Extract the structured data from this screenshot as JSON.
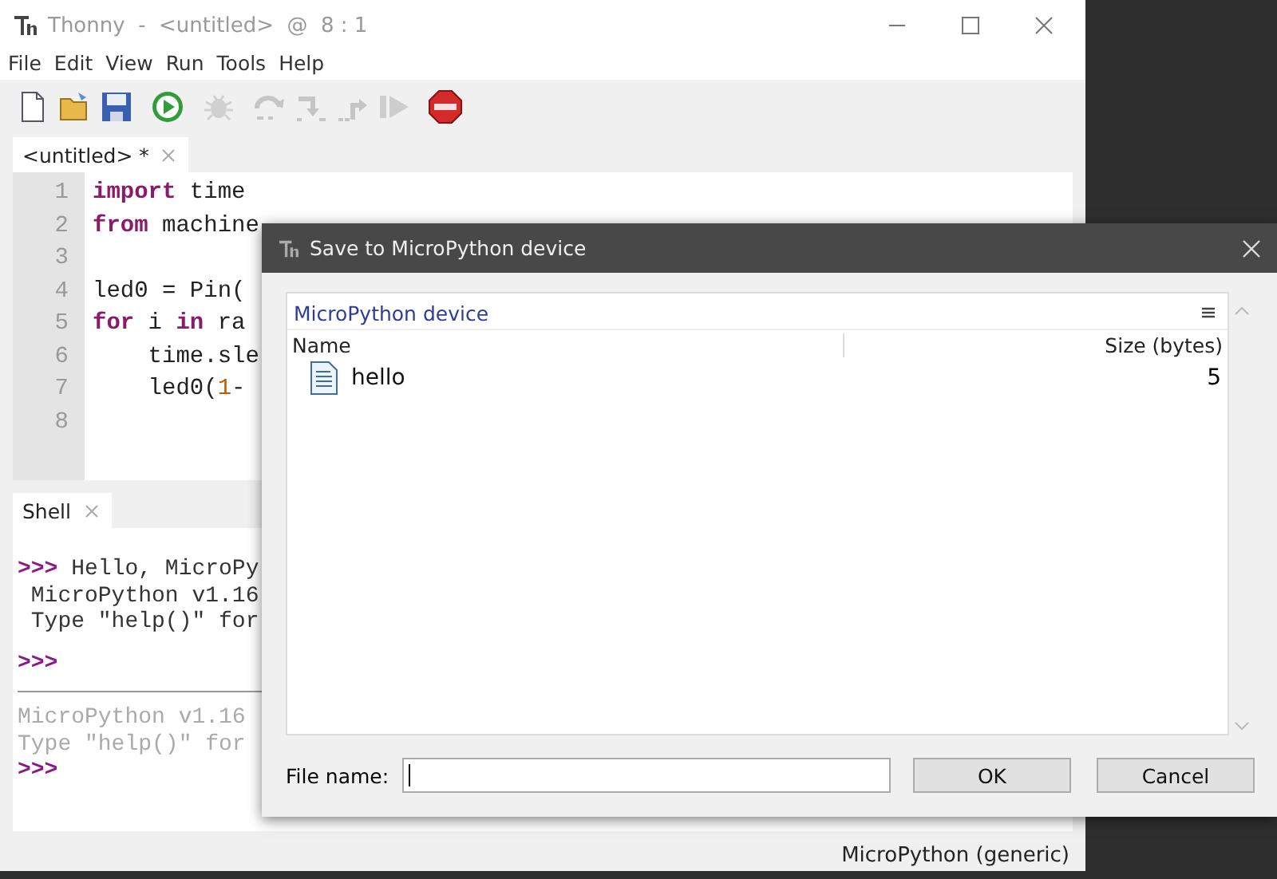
{
  "window": {
    "title": "Thonny  -  <untitled>  @  8 : 1"
  },
  "menu": [
    "File",
    "Edit",
    "View",
    "Run",
    "Tools",
    "Help"
  ],
  "toolbar": [
    {
      "kind": "new",
      "disabled": false
    },
    {
      "kind": "open",
      "disabled": false
    },
    {
      "kind": "save",
      "disabled": false
    },
    {
      "kind": "run",
      "disabled": false
    },
    {
      "kind": "debug",
      "disabled": true
    },
    {
      "kind": "step-over",
      "disabled": true
    },
    {
      "kind": "step-into",
      "disabled": true
    },
    {
      "kind": "step-out",
      "disabled": true
    },
    {
      "kind": "resume",
      "disabled": true
    },
    {
      "kind": "stop",
      "disabled": false
    }
  ],
  "editor": {
    "tabs": [
      {
        "label": "<untitled> *",
        "selected": true
      }
    ],
    "lines": [
      {
        "number": "1",
        "tokens": [
          {
            "kind": "kw",
            "text": "import"
          },
          {
            "kind": "plain",
            "text": " time"
          }
        ]
      },
      {
        "number": "2",
        "tokens": [
          {
            "kind": "kw",
            "text": "from"
          },
          {
            "kind": "plain",
            "text": " machine"
          }
        ]
      },
      {
        "number": "3"
      },
      {
        "number": "4",
        "tokens": [
          {
            "kind": "plain",
            "text": "led0 = Pin("
          }
        ]
      },
      {
        "number": "5",
        "tokens": [
          {
            "kind": "kw",
            "text": "for"
          },
          {
            "kind": "plain",
            "text": " i "
          },
          {
            "kind": "kw",
            "text": "in"
          },
          {
            "kind": "plain",
            "text": " ra"
          }
        ]
      },
      {
        "number": "6",
        "tokens": [
          {
            "kind": "plain",
            "text": "    time.sle"
          }
        ]
      },
      {
        "number": "7",
        "tokens": [
          {
            "kind": "plain",
            "text": "    led0("
          },
          {
            "kind": "num",
            "text": "1"
          },
          {
            "kind": "plain",
            "text": "-"
          }
        ]
      },
      {
        "number": "8"
      }
    ]
  },
  "shell": {
    "tabs": [
      {
        "label": "Shell",
        "selected": true
      }
    ],
    "lines": [
      {
        "kind": "prompt",
        "prompt": ">>>",
        "text": " Hello, MicroPy"
      },
      {
        "kind": "output",
        "text": " MicroPython v1.16"
      },
      {
        "kind": "output",
        "text": " Type \"help()\" for"
      },
      {
        "kind": "prompt",
        "prompt": ">>>"
      },
      {
        "kind": "separator"
      },
      {
        "kind": "faded",
        "text": "MicroPython v1.16"
      },
      {
        "kind": "faded",
        "text": "Type \"help()\" for"
      },
      {
        "kind": "prompt",
        "prompt": ">>>"
      }
    ]
  },
  "status_bar": {
    "backend": "MicroPython (generic)"
  },
  "dialog": {
    "title": "Save to MicroPython device",
    "browser": {
      "location": "MicroPython device",
      "columns": [
        "Name",
        "Size (bytes)"
      ],
      "rows": [
        {
          "kind": "file",
          "name": "hello",
          "size": "5",
          "selected": false
        }
      ]
    },
    "file_name": {
      "label": "File name:"
    },
    "buttons": [
      "OK",
      "Cancel"
    ]
  }
}
